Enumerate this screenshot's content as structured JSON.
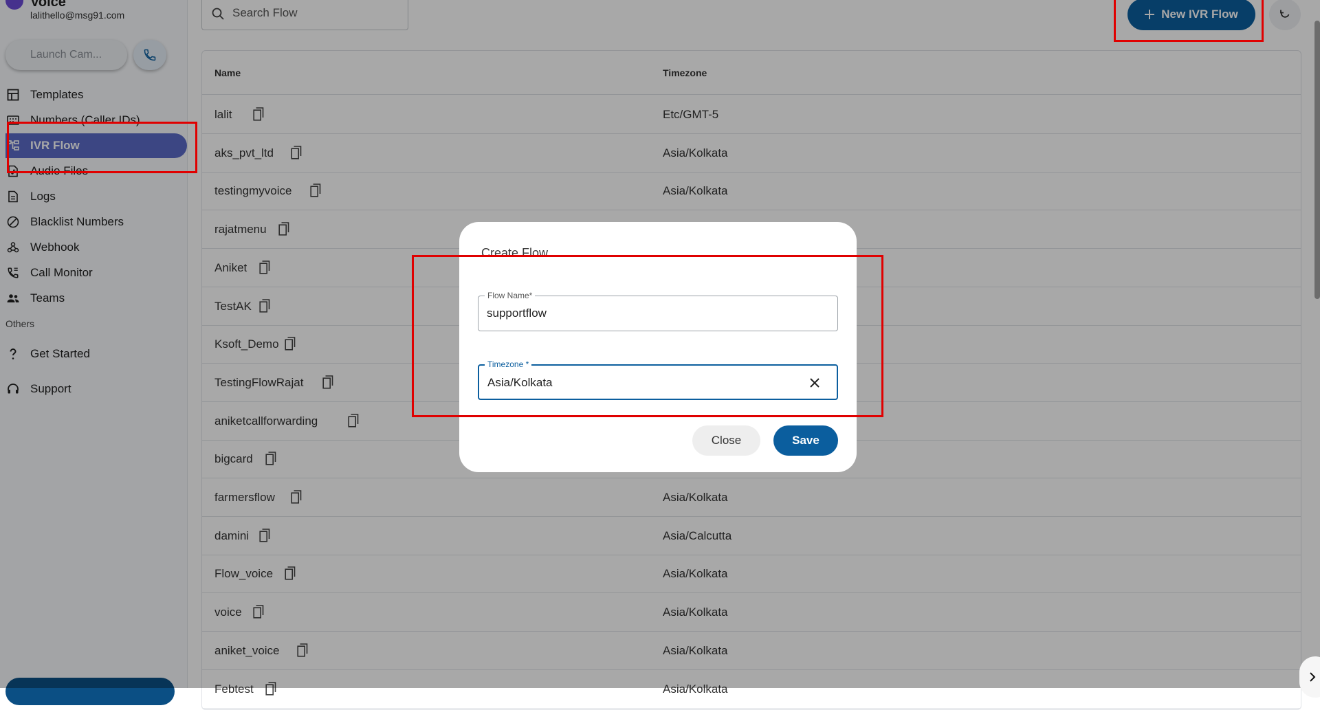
{
  "account": {
    "name": "Voice",
    "email": "lalithello@msg91.com"
  },
  "sidebar": {
    "launch_label": "Launch Cam...",
    "items": [
      {
        "label": "Templates",
        "icon": "template-icon"
      },
      {
        "label": "Numbers (Caller IDs)",
        "icon": "dialpad-icon"
      },
      {
        "label": "IVR Flow",
        "icon": "flow-icon",
        "active": true
      },
      {
        "label": "Audio Files",
        "icon": "audio-file-icon"
      },
      {
        "label": "Logs",
        "icon": "document-icon"
      },
      {
        "label": "Blacklist Numbers",
        "icon": "block-icon"
      },
      {
        "label": "Webhook",
        "icon": "webhook-icon"
      },
      {
        "label": "Call Monitor",
        "icon": "phone-monitor-icon"
      },
      {
        "label": "Teams",
        "icon": "people-icon"
      }
    ],
    "others_label": "Others",
    "others": [
      {
        "label": "Get Started",
        "icon": "question-icon"
      },
      {
        "label": "Support",
        "icon": "headset-icon"
      }
    ]
  },
  "toolbar": {
    "search_placeholder": "Search Flow",
    "new_flow_label": "New IVR Flow"
  },
  "table": {
    "columns": [
      "Name",
      "Timezone"
    ],
    "rows": [
      {
        "name": "lalit",
        "timezone": "Etc/GMT-5"
      },
      {
        "name": "aks_pvt_ltd",
        "timezone": "Asia/Kolkata"
      },
      {
        "name": "testingmyvoice",
        "timezone": "Asia/Kolkata"
      },
      {
        "name": "rajatmenu",
        "timezone": ""
      },
      {
        "name": "Aniket",
        "timezone": ""
      },
      {
        "name": "TestAK",
        "timezone": ""
      },
      {
        "name": "Ksoft_Demo",
        "timezone": ""
      },
      {
        "name": "TestingFlowRajat",
        "timezone": ""
      },
      {
        "name": "aniketcallforwarding",
        "timezone": ""
      },
      {
        "name": "bigcard",
        "timezone": ""
      },
      {
        "name": "farmersflow",
        "timezone": "Asia/Kolkata"
      },
      {
        "name": "damini",
        "timezone": "Asia/Calcutta"
      },
      {
        "name": "Flow_voice",
        "timezone": "Asia/Kolkata"
      },
      {
        "name": "voice",
        "timezone": "Asia/Kolkata"
      },
      {
        "name": "aniket_voice",
        "timezone": "Asia/Kolkata"
      },
      {
        "name": "Febtest",
        "timezone": "Asia/Kolkata"
      }
    ]
  },
  "dialog": {
    "title": "Create Flow",
    "flow_name_label": "Flow Name*",
    "flow_name_value": "supportflow",
    "timezone_label": "Timezone *",
    "timezone_value": "Asia/Kolkata",
    "close_label": "Close",
    "save_label": "Save"
  },
  "colors": {
    "primary": "#0b5e9e",
    "sidebar_active": "#5c6bc7",
    "annotation": "#e00000"
  }
}
